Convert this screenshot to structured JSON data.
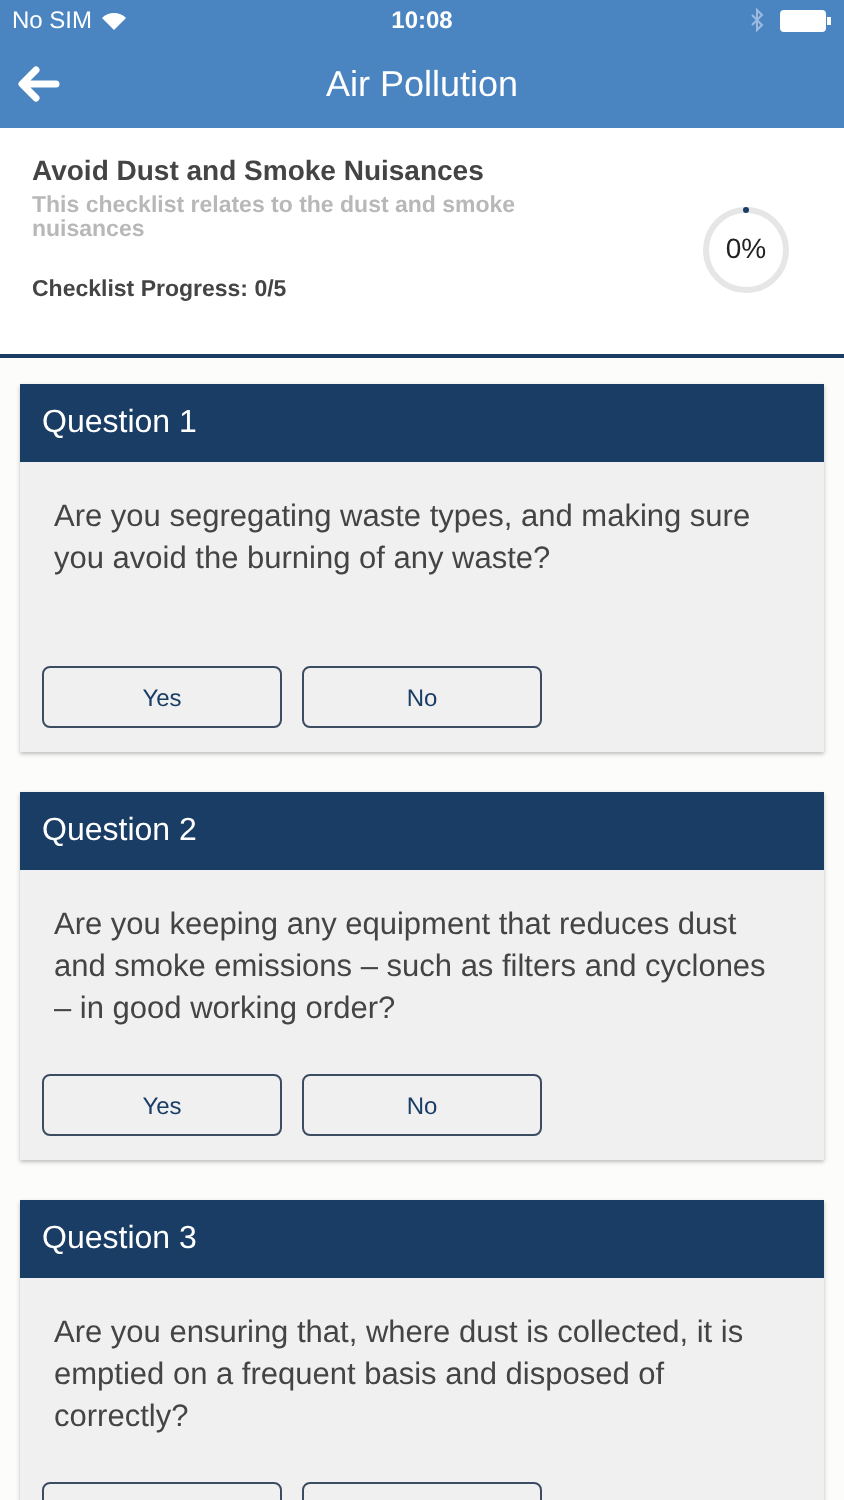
{
  "status_bar": {
    "carrier": "No SIM",
    "time": "10:08"
  },
  "nav_bar": {
    "title": "Air Pollution"
  },
  "checklist": {
    "title": "Avoid Dust and Smoke Nuisances",
    "description": "This checklist relates to the dust and smoke nuisances",
    "progress_label": "Checklist Progress: 0/5",
    "progress": {
      "level": 0,
      "reading": "0%"
    }
  },
  "questions": [
    {
      "title": "Question 1",
      "text": "Are you segregating waste types, and making sure you avoid the burning of any waste?",
      "kind": "full",
      "answers": [
        {
          "label": "Yes",
          "selected": false
        },
        {
          "label": "No",
          "selected": false
        }
      ]
    },
    {
      "title": "Question 2",
      "text": "Are you keeping any equipment that reduces dust and smoke emissions – such as filters and cyclones – in good working order?",
      "kind": "full",
      "answers": [
        {
          "label": "Yes",
          "selected": false
        },
        {
          "label": "No",
          "selected": false
        }
      ]
    },
    {
      "title": "Question 3",
      "text": "Are you ensuring that, where dust is collected, it is emptied on a frequent basis and disposed of correctly?",
      "kind": "cut"
    }
  ]
}
